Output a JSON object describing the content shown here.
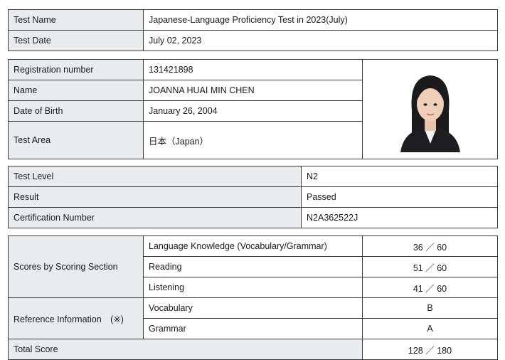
{
  "test_info": {
    "test_name_label": "Test Name",
    "test_name_value": "Japanese-Language Proficiency Test in 2023(July)",
    "test_date_label": "Test Date",
    "test_date_value": "July 02, 2023"
  },
  "examinee": {
    "registration_label": "Registration number",
    "registration_value": "131421898",
    "name_label": "Name",
    "name_value": "JOANNA HUAI MIN CHEN",
    "dob_label": "Date of Birth",
    "dob_value": "January 26, 2004",
    "area_label": "Test Area",
    "area_value": "日本（Japan）"
  },
  "result_info": {
    "level_label": "Test Level",
    "level_value": "N2",
    "result_label": "Result",
    "result_value": "Passed",
    "cert_label": "Certification Number",
    "cert_value": "N2A362522J"
  },
  "scores": {
    "section_label": "Scores by Scoring Section",
    "language_knowledge_label": "Language Knowledge (Vocabulary/Grammar)",
    "language_knowledge_score": "36 ／ 60",
    "reading_label": "Reading",
    "reading_score": "51 ／ 60",
    "listening_label": "Listening",
    "listening_score": "41 ／ 60",
    "reference_label": "Reference Information　(※)",
    "vocabulary_label": "Vocabulary",
    "vocabulary_grade": "B",
    "grammar_label": "Grammar",
    "grammar_grade": "A",
    "total_label": "Total Score",
    "total_value": "128 ／ 180"
  }
}
